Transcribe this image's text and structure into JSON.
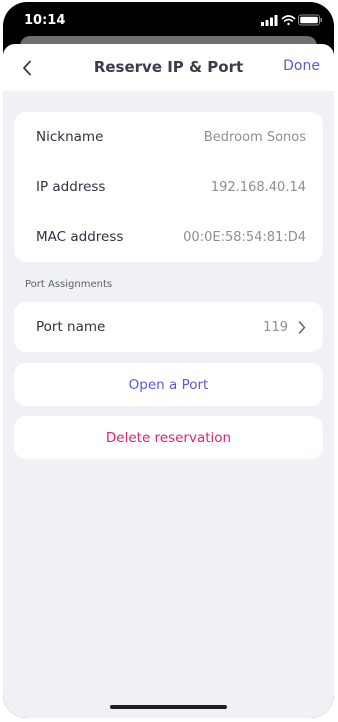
{
  "status_bar": {
    "time": "10:14",
    "icons": [
      "cellular-signal-icon",
      "wifi-icon",
      "battery-icon"
    ]
  },
  "nav": {
    "title": "Reserve IP & Port",
    "done_label": "Done",
    "back_icon": "chevron-left-icon"
  },
  "details": [
    {
      "label": "Nickname",
      "value": "Bedroom Sonos"
    },
    {
      "label": "IP address",
      "value": "192.168.40.14"
    },
    {
      "label": "MAC address",
      "value": "00:0E:58:54:81:D4"
    }
  ],
  "port_section": {
    "header": "Port Assignments",
    "row": {
      "label": "Port name",
      "value": "119",
      "icon": "chevron-right-icon"
    }
  },
  "actions": {
    "open_port": "Open a Port",
    "delete_reservation": "Delete reservation"
  },
  "colors": {
    "accent": "#5b5bd6",
    "destructive": "#e0207a",
    "background": "#eff1f4",
    "card": "#ffffff"
  }
}
